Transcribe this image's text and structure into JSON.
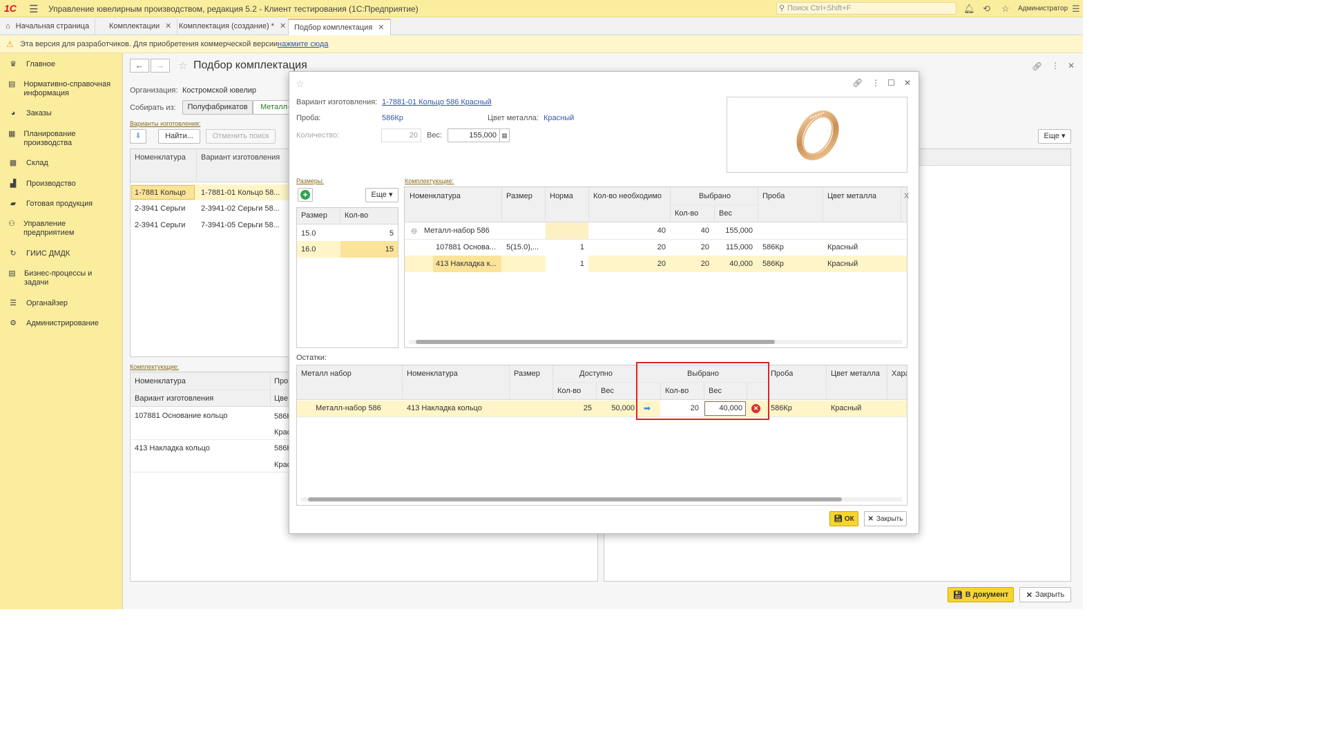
{
  "titlebar": {
    "logo": "1С",
    "title": "Управление ювелирным производством, редакция 5.2  - Клиент тестирования (1С:Предприятие)",
    "search_placeholder": "Поиск Ctrl+Shift+F",
    "user": "Администратор"
  },
  "tabs": [
    {
      "label": "Начальная страница"
    },
    {
      "label": "Комплектации"
    },
    {
      "label": "Комплектация (создание) *"
    },
    {
      "label": "Подбор комплектация"
    }
  ],
  "dev_banner": {
    "text": "Эта версия для разработчиков. Для приобретения коммерческой версии",
    "link": "нажмите сюда",
    "dot": "."
  },
  "sidebar": {
    "items": [
      {
        "label": "Главное",
        "icon": "crown-icon"
      },
      {
        "label": "Нормативно-справочная информация",
        "icon": "book-icon"
      },
      {
        "label": "Заказы",
        "icon": "pie-chart-icon"
      },
      {
        "label": "Планирование производства",
        "icon": "clipboard-icon"
      },
      {
        "label": "Склад",
        "icon": "grid-icon"
      },
      {
        "label": "Производство",
        "icon": "factory-icon"
      },
      {
        "label": "Готовая продукция",
        "icon": "bag-icon"
      },
      {
        "label": "Управление предприятием",
        "icon": "org-icon"
      },
      {
        "label": "ГИИС ДМДК",
        "icon": "sync-icon"
      },
      {
        "label": "Бизнес-процессы и задачи",
        "icon": "list-icon"
      },
      {
        "label": "Органайзер",
        "icon": "organizer-icon"
      },
      {
        "label": "Администрирование",
        "icon": "gear-icon"
      }
    ]
  },
  "main": {
    "title": "Подбор комплектация",
    "org_label": "Организация:",
    "org_value": "Костромской ювелир",
    "collect_label": "Собирать из:",
    "collect_btn1": "Полуфабрикатов",
    "collect_btn2": "Металл-",
    "variants_link": "Варианты изготовления:",
    "find_btn": "Найти...",
    "cancel_search_btn": "Отменить поиск",
    "more_btn": "Еще",
    "variants_grid": {
      "headers": [
        "Номенклатура",
        "Вариант изготовления"
      ],
      "rows": [
        [
          "1-7881 Кольцо",
          "1-7881-01 Кольцо 58..."
        ],
        [
          "2-3941 Серьги",
          "2-3941-02 Серьги 58..."
        ],
        [
          "2-3941 Серьги",
          "7-3941-05 Серьги 58..."
        ]
      ]
    },
    "components_link": "Комплектующие:",
    "components_grid": {
      "headers": [
        "Номенклатура",
        "Про"
      ],
      "subheaders": [
        "Вариант изготовления",
        "Цве"
      ],
      "rows": [
        [
          "107881 Основание кольцо",
          "586К",
          "Крас"
        ],
        [
          "413 Накладка кольцо",
          "586К",
          "Крас"
        ]
      ]
    },
    "btn_to_doc": "В документ",
    "btn_close": "Закрыть"
  },
  "modal": {
    "variant_label": "Вариант изготовления:",
    "variant_value": "1-7881-01 Кольцо 586 Красный",
    "proba_label": "Проба:",
    "proba_value": "586Кр",
    "metal_color_label": "Цвет металла:",
    "metal_color_value": "Красный",
    "qty_label": "Количество:",
    "qty_value": "20",
    "weight_label": "Вес:",
    "weight_value": "155,000",
    "sizes_link": "Размеры:",
    "sizes_more": "Еще",
    "sizes_grid": {
      "headers": [
        "Размер",
        "Кол-во"
      ],
      "rows": [
        [
          "15.0",
          "5"
        ],
        [
          "16.0",
          "15"
        ]
      ]
    },
    "comp_link": "Комплектующие:",
    "comp_grid": {
      "headers": [
        "Номенклатура",
        "Размер",
        "Норма",
        "Кол-во  необходимо",
        "Выбрано",
        "Проба",
        "Цвет металла"
      ],
      "subheaders": [
        "Кол-во",
        "Вес"
      ],
      "rows": [
        {
          "name": "Металл-набор 586",
          "size": "",
          "norm": "",
          "need": "40",
          "sel_qty": "40",
          "sel_w": "155,000",
          "proba": "",
          "color": ""
        },
        {
          "name": "107881 Основа...",
          "size": "5(15.0),...",
          "norm": "1",
          "need": "20",
          "sel_qty": "20",
          "sel_w": "115,000",
          "proba": "586Кр",
          "color": "Красный"
        },
        {
          "name": "413 Накладка к...",
          "size": "",
          "norm": "1",
          "need": "20",
          "sel_qty": "20",
          "sel_w": "40,000",
          "proba": "586Кр",
          "color": "Красный"
        }
      ]
    },
    "rem_label": "Остатки:",
    "rem_grid": {
      "headers": [
        "Металл набор",
        "Номенклатура",
        "Размер",
        "Доступно",
        "Выбрано",
        "Проба",
        "Цвет металла",
        "Хара"
      ],
      "subheaders": [
        "Кол-во",
        "Вес",
        "Кол-во",
        "Вес"
      ],
      "row": {
        "set": "Металл-набор 586",
        "name": "413 Накладка кольцо",
        "size": "",
        "avail_qty": "25",
        "avail_w": "50,000",
        "sel_qty": "20",
        "sel_w": "40,000",
        "proba": "586Кр",
        "color": "Красный"
      }
    },
    "ok_btn": "ОК",
    "close_btn": "Закрыть"
  },
  "colors": {
    "accent": "#fbed9e",
    "ok": "#f5d52e",
    "highlight": "#e02020"
  }
}
